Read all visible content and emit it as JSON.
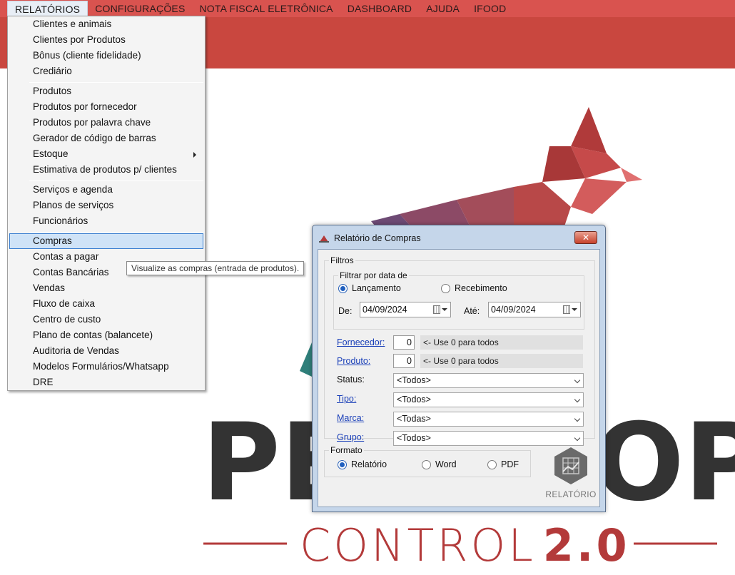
{
  "menubar": {
    "items": [
      "RELATÓRIOS",
      "CONFIGURAÇÕES",
      "NOTA FISCAL ELETRÔNICA",
      "DASHBOARD",
      "AJUDA",
      "IFOOD"
    ]
  },
  "menu": {
    "items": [
      "Clientes e animais",
      "Clientes por Produtos",
      "Bônus (cliente fidelidade)",
      "Crediário",
      "Produtos",
      "Produtos por fornecedor",
      "Produtos por palavra chave",
      "Gerador de código de barras",
      "Estoque",
      "Estimativa de produtos p/ clientes",
      "Serviços e agenda",
      "Planos de serviços",
      "Funcionários",
      "Compras",
      "Contas a pagar",
      "Contas Bancárias",
      "Vendas",
      "Fluxo de caixa",
      "Centro de custo",
      "Plano de contas (balancete)",
      "Auditoria de Vendas",
      "Modelos Formulários/Whatsapp",
      "DRE"
    ],
    "tooltip": "Visualize as compras (entrada de produtos)."
  },
  "background": {
    "logo_line1": "PETSHOP",
    "logo_line2_a": "C",
    "logo_line2_b": "NTROL",
    "logo_line2_c": "2.0",
    "colors": {
      "banner": "#c9473f",
      "menubar": "#d9534f",
      "logo_red": "#b33a3a",
      "logo_dark": "#333333"
    }
  },
  "dialog": {
    "title": "Relatório de Compras",
    "close_label": "✕",
    "filters_legend": "Filtros",
    "date_legend": "Filtrar por data de",
    "radio_lancamento": "Lançamento",
    "radio_recebimento": "Recebimento",
    "from_label": "De:",
    "from_value": "04/09/2024",
    "to_label": "Até:",
    "to_value": "04/09/2024",
    "fornecedor_label": "Fornecedor:",
    "fornecedor_value": "0",
    "fornecedor_hint": "<- Use 0 para todos",
    "produto_label": "Produto:",
    "produto_value": "0",
    "produto_hint": "<- Use 0 para todos",
    "status_label": "Status:",
    "status_value": "<Todos>",
    "tipo_label": "Tipo:",
    "tipo_value": "<Todos>",
    "marca_label": "Marca:",
    "marca_value": "<Todas>",
    "grupo_label": "Grupo:",
    "grupo_value": "<Todos>",
    "format_legend": "Formato",
    "format_relatorio": "Relatório",
    "format_word": "Word",
    "format_pdf": "PDF",
    "report_button": "RELATÓRIO"
  }
}
